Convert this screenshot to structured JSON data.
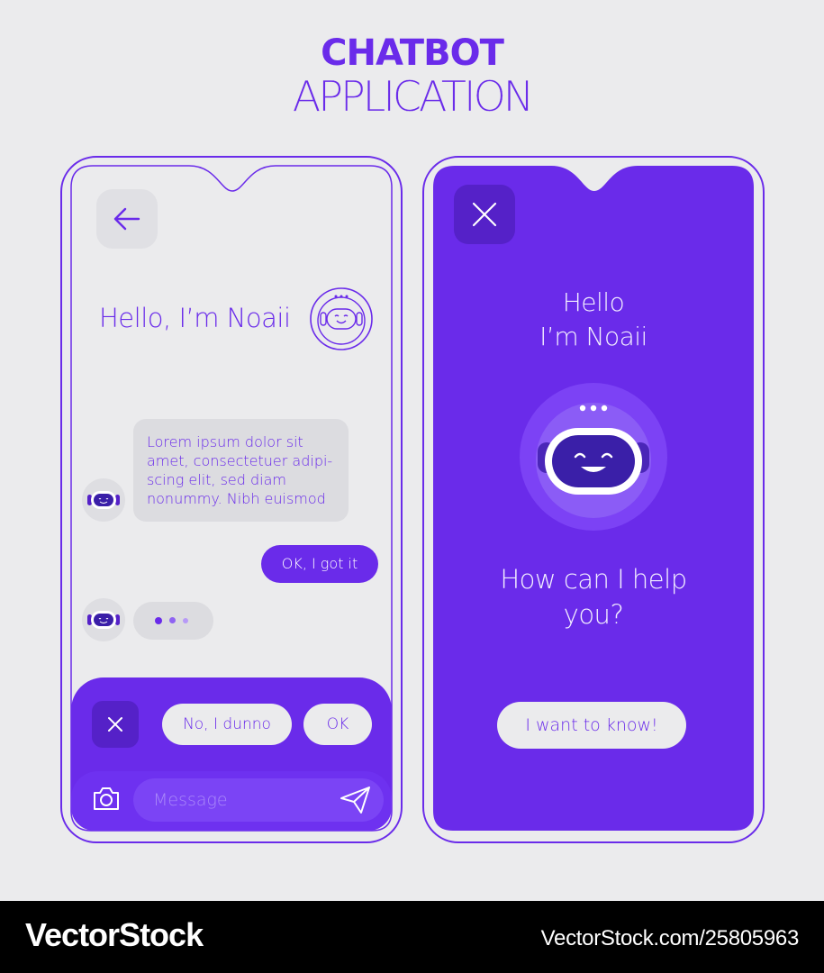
{
  "header": {
    "title": "CHATBOT",
    "subtitle": "APPLICATION"
  },
  "left_screen": {
    "greeting": "Hello, I’m Noaii",
    "bot_message": "Lorem ipsum dolor sit amet, consectetuer adipi-scing elit, sed diam nonummy. Nibh euismod",
    "user_reply": "OK, I got it",
    "quick_replies": [
      "No, I dunno",
      "OK"
    ],
    "message_placeholder": "Message",
    "icons": [
      "back-arrow-icon",
      "robot-avatar-icon",
      "close-icon",
      "camera-icon",
      "send-icon"
    ]
  },
  "right_screen": {
    "greeting_line1": "Hello",
    "greeting_line2": "I’m Noaii",
    "question_line1": "How can I help",
    "question_line2": "you?",
    "cta_label": "I want to know!",
    "icons": [
      "close-icon",
      "robot-avatar-icon"
    ]
  },
  "footer": {
    "brand": "VectorStock",
    "url": "VectorStock.com/25805963"
  },
  "colors": {
    "primary": "#6a2bea",
    "primary_dark": "#5521c8",
    "background": "#ebebed",
    "bubble_gray": "#dcdce0"
  }
}
